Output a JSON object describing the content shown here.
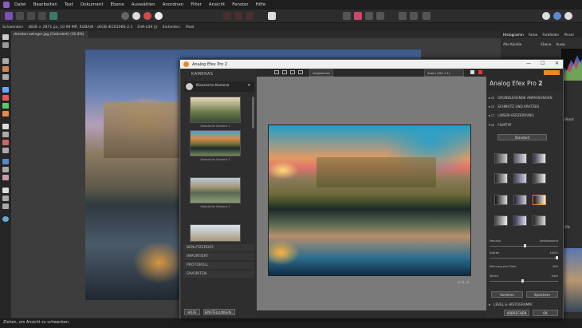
{
  "menu": [
    "Datei",
    "Bearbeiten",
    "Text",
    "Dokument",
    "Ebene",
    "Auswählen",
    "Anordnen",
    "Filter",
    "Ansicht",
    "Fenster",
    "Hilfe"
  ],
  "context": {
    "mode": "Schwenken",
    "dims": "3828 × 2871 px, 10.99 MP, RGBA/8 - sRGB IEC61966-2.1",
    "lens": "EVA-L09 (j)",
    "units_label": "Einheiten:",
    "units": "Pixel"
  },
  "document_tab": "dresden-zwinger.jpg (Geändert) (30.8%)",
  "statusbar": "Ziehen, um Ansicht zu schwenken.",
  "right_panel": {
    "tabs": [
      "Histogramm",
      "Farbe",
      "Farbfelder",
      "Pinsel"
    ],
    "layer_tabs": [
      "Alle Kanäle",
      "Ebene",
      "Ausw."
    ],
    "side_labels": [
      "Block",
      "0%"
    ]
  },
  "efex": {
    "title": "Analog Efex Pro 2",
    "window_controls": [
      "—",
      "☐",
      "✕"
    ],
    "left_header": "KAMERAS",
    "camera_selected": "Klassische Kamera",
    "thumb_captions": [
      "Klassische Kamera 1",
      "Klassische Kamera 2",
      "Klassische Kamera 3"
    ],
    "sections": [
      "BENUTZERDEF.",
      "IMPORTIERT",
      "PROTOKOLL",
      "FAVORITEN"
    ],
    "bottom_left_buttons": [
      "HILFE",
      "EINSTELLUNGEN..."
    ],
    "view_label": "Vergleichen",
    "zoom_label": "Zoom (Stil 1:1)",
    "coords": "0 / 0 / 0",
    "brand": "Analog Efex Pro",
    "brand_num": "2",
    "right_sections": [
      "GRUNDLEGENDE ANPASSUNGEN",
      "SCHMUTZ UND KRATZER",
      "LINSEN-VERZERRUNG",
      "FILMTYP"
    ],
    "filmtype_select": "Standard",
    "slider_labels": [
      {
        "left": "Neutral",
        "right": "Verblassend"
      },
      {
        "left": "Stärke",
        "right": "100%"
      },
      {
        "left": "Körnung pro Pixel",
        "right": "400"
      },
      {
        "left": "Weich",
        "right": "Hart"
      }
    ],
    "panel_buttons": [
      "Variieren",
      "Speichern"
    ],
    "last_section": "LEVEL & HISTOGRAMM",
    "bottom_right_buttons": [
      "ABBRECHEN",
      "OK"
    ]
  },
  "colors": {
    "accent": "#8c5ac8",
    "orange": "#e98a2a"
  }
}
